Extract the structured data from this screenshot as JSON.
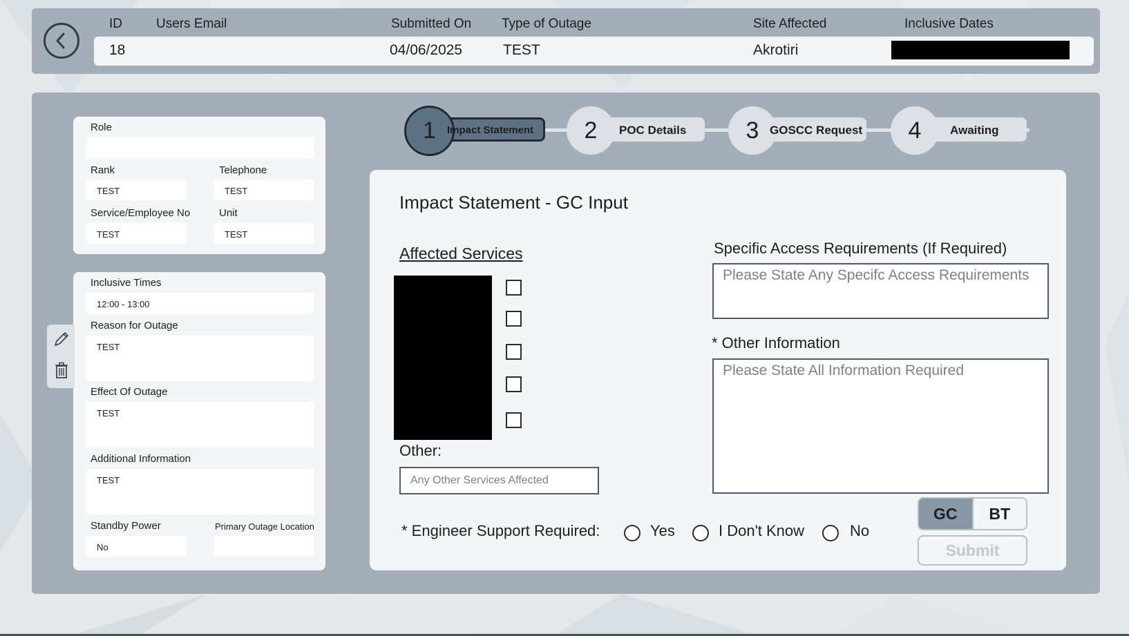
{
  "header": {
    "columns": {
      "id": "ID",
      "email": "Users Email",
      "submitted": "Submitted On",
      "type": "Type of Outage",
      "site": "Site Affected",
      "dates": "Inclusive Dates"
    },
    "values": {
      "id": "18",
      "email": "",
      "submitted": "04/06/2025",
      "type": "TEST",
      "site": "Akrotiri"
    }
  },
  "details_card": {
    "role_label": "Role",
    "role_value": "",
    "rank_label": "Rank",
    "rank_value": "TEST",
    "telephone_label": "Telephone",
    "telephone_value": "TEST",
    "service_no_label": "Service/Employee No",
    "service_no_value": "TEST",
    "unit_label": "Unit",
    "unit_value": "TEST"
  },
  "outage_card": {
    "times_label": "Inclusive Times",
    "times_value": "12:00 - 13:00",
    "reason_label": "Reason for Outage",
    "reason_value": "TEST",
    "effect_label": "Effect Of Outage",
    "effect_value": "TEST",
    "additional_label": "Additional Information",
    "additional_value": "TEST",
    "standby_label": "Standby Power",
    "standby_value": "No",
    "location_label": "Primary Outage Location",
    "location_value": ""
  },
  "steps": [
    {
      "number": "1",
      "label": "Impact Statement",
      "active": true
    },
    {
      "number": "2",
      "label": "POC Details",
      "active": false
    },
    {
      "number": "3",
      "label": "GOSCC Request",
      "active": false
    },
    {
      "number": "4",
      "label": "Awaiting",
      "active": false
    }
  ],
  "panel": {
    "title": "Impact Statement - GC Input",
    "affected_label": "Affected Services",
    "other_label": "Other:",
    "other_placeholder": "Any Other Services Affected",
    "access_label": "Specific Access Requirements (If Required)",
    "access_placeholder": "Please State Any Specifc Access Requirements",
    "other_info_label": "* Other Information",
    "other_info_placeholder": "Please State All Information Required",
    "engineer_label": "* Engineer Support Required:",
    "radio_yes": "Yes",
    "radio_dontknow": "I Don't Know",
    "radio_no": "No",
    "toggle_gc": "GC",
    "toggle_bt": "BT",
    "toggle_selected": "GC",
    "submit_label": "Submit"
  },
  "icons": {
    "back": "chevron-left-icon",
    "edit": "pencil-icon",
    "delete": "trash-icon"
  },
  "colors": {
    "panel_gray": "#a3aeb8",
    "active_step": "#5f7284",
    "card_bg": "#f4f5f6"
  }
}
